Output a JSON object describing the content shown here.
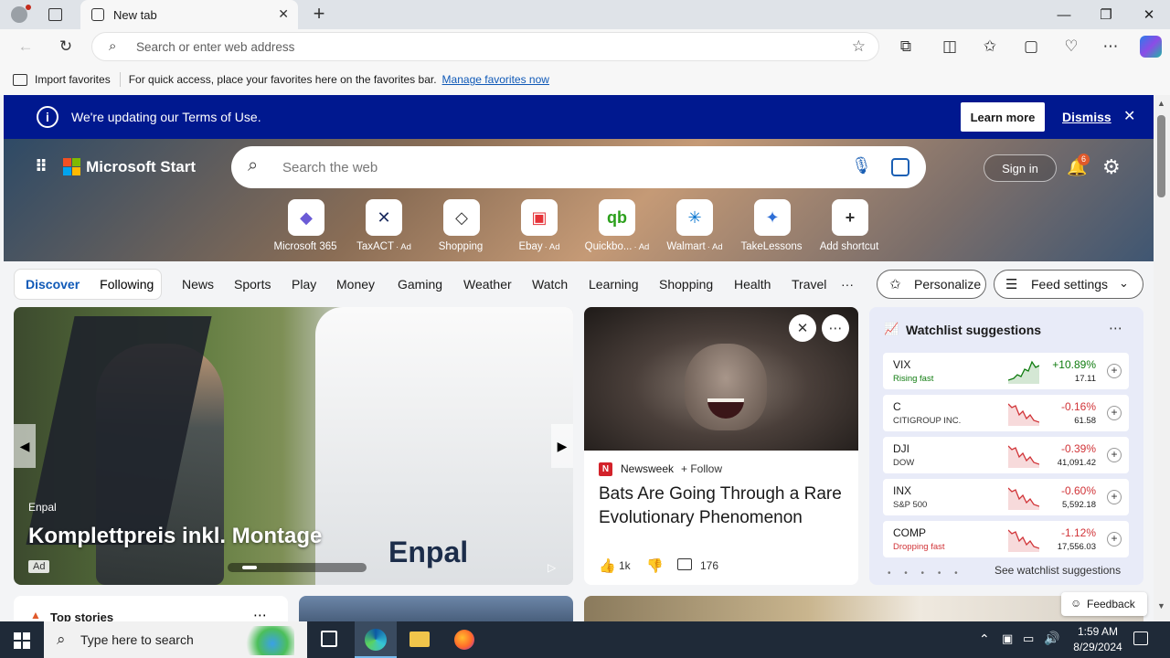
{
  "browser": {
    "tab_title": "New tab",
    "address_placeholder": "Search or enter web address"
  },
  "favorites_bar": {
    "import_label": "Import favorites",
    "message": "For quick access, place your favorites here on the favorites bar.",
    "manage_link": "Manage favorites now"
  },
  "banner": {
    "message": "We're updating our Terms of Use.",
    "learn_more": "Learn more",
    "dismiss": "Dismiss"
  },
  "header": {
    "brand": "Microsoft Start",
    "search_placeholder": "Search the web",
    "sign_in": "Sign in",
    "notification_count": "6"
  },
  "shortcuts": [
    {
      "label": "Microsoft 365",
      "ad": "",
      "icon": "microsoft-365-icon",
      "glyph": "◆",
      "color": "#6b5bd6"
    },
    {
      "label": "TaxACT",
      "ad": "· Ad",
      "icon": "taxact-icon",
      "glyph": "✕",
      "color": "#1a2a5e"
    },
    {
      "label": "Shopping",
      "ad": "",
      "icon": "shopping-tag-icon",
      "glyph": "◇",
      "color": "#333"
    },
    {
      "label": "Ebay",
      "ad": "· Ad",
      "icon": "ebay-icon",
      "glyph": "▣",
      "color": "#e53238"
    },
    {
      "label": "Quickbo...",
      "ad": "· Ad",
      "icon": "quickbooks-icon",
      "glyph": "qb",
      "color": "#2ca01c"
    },
    {
      "label": "Walmart",
      "ad": "· Ad",
      "icon": "walmart-icon",
      "glyph": "✳",
      "color": "#0071ce"
    },
    {
      "label": "TakeLessons",
      "ad": "",
      "icon": "takelessons-icon",
      "glyph": "✦",
      "color": "#2f6fd6"
    },
    {
      "label": "Add shortcut",
      "ad": "",
      "icon": "plus-icon",
      "glyph": "+",
      "color": "#333"
    }
  ],
  "feed_nav": {
    "discover": "Discover",
    "following": "Following",
    "items": [
      "News",
      "Sports",
      "Play",
      "Money",
      "Gaming",
      "Weather",
      "Watch",
      "Learning",
      "Shopping",
      "Health",
      "Travel"
    ],
    "more": "···",
    "personalize": "Personalize",
    "feed_settings": "Feed settings"
  },
  "hero_card": {
    "source": "Enpal",
    "title": "Komplettpreis inkl. Montage",
    "ad_badge": "Ad",
    "van_text": "Enpal"
  },
  "news_card": {
    "source": "Newsweek",
    "follow": "+ Follow",
    "title": "Bats Are Going Through a Rare Evolutionary Phenomenon",
    "likes": "1k",
    "comments": "176"
  },
  "watchlist": {
    "title": "Watchlist suggestions",
    "see_more": "See watchlist suggestions",
    "items": [
      {
        "symbol": "VIX",
        "name": "Rising fast",
        "change": "+10.89%",
        "price": "17.11",
        "trend": "up"
      },
      {
        "symbol": "C",
        "name": "CITIGROUP INC.",
        "change": "-0.16%",
        "price": "61.58",
        "trend": "down"
      },
      {
        "symbol": "DJI",
        "name": "DOW",
        "change": "-0.39%",
        "price": "41,091.42",
        "trend": "down"
      },
      {
        "symbol": "INX",
        "name": "S&P 500",
        "change": "-0.60%",
        "price": "5,592.18",
        "trend": "down"
      },
      {
        "symbol": "COMP",
        "name": "Dropping fast",
        "change": "-1.12%",
        "price": "17,556.03",
        "trend": "down"
      }
    ]
  },
  "bottom_row": {
    "top_stories": "Top stories",
    "feedback": "Feedback"
  },
  "taskbar": {
    "search_placeholder": "Type here to search",
    "time": "1:59 AM",
    "date": "8/29/2024"
  },
  "colors": {
    "banner_bg": "#00188f",
    "accent": "#0f59b7",
    "up": "#107c10",
    "down": "#d13438"
  }
}
